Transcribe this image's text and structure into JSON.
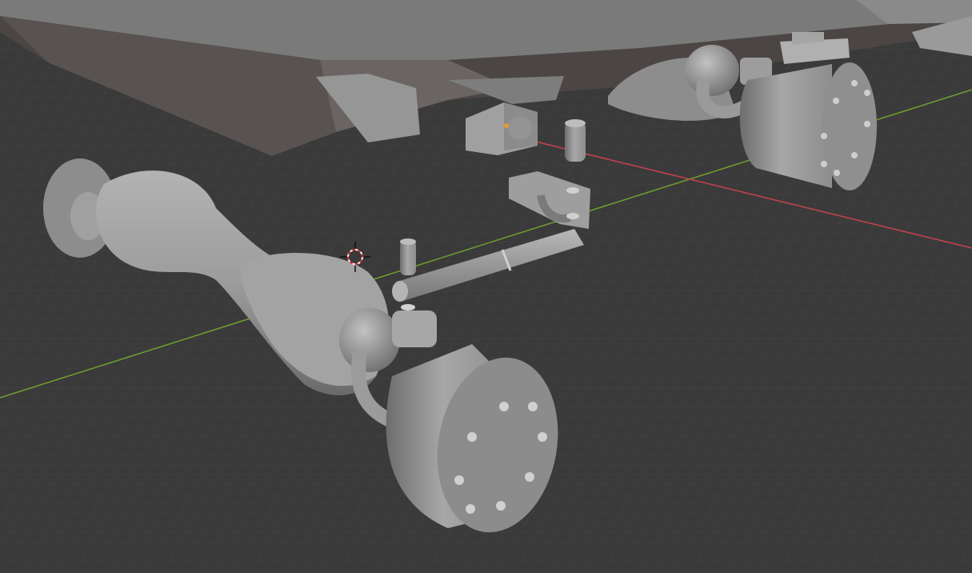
{
  "app": {
    "name": "3D Viewport"
  },
  "viewport": {
    "background_color": "#3a3a3a",
    "grid_color": "#4a4a4a",
    "x_axis_color": "#c0424f",
    "y_axis_color": "#6e9a32",
    "mesh_color": "#a8a8a8",
    "mesh_dark_color": "#4a4542",
    "cursor": {
      "icon": "3d-cursor-icon"
    },
    "origin_marker": {
      "icon": "object-origin-dot",
      "color": "#e59a2a"
    }
  },
  "objects": [
    {
      "name": "hull-underside"
    },
    {
      "name": "axle-assembly-front"
    },
    {
      "name": "wheel-hub-front"
    },
    {
      "name": "axle-assembly-rear"
    },
    {
      "name": "wheel-hub-rear"
    },
    {
      "name": "steering-link-rod"
    },
    {
      "name": "clevis-bracket"
    },
    {
      "name": "mount-block"
    },
    {
      "name": "pin-small-1"
    },
    {
      "name": "pin-small-2"
    }
  ]
}
